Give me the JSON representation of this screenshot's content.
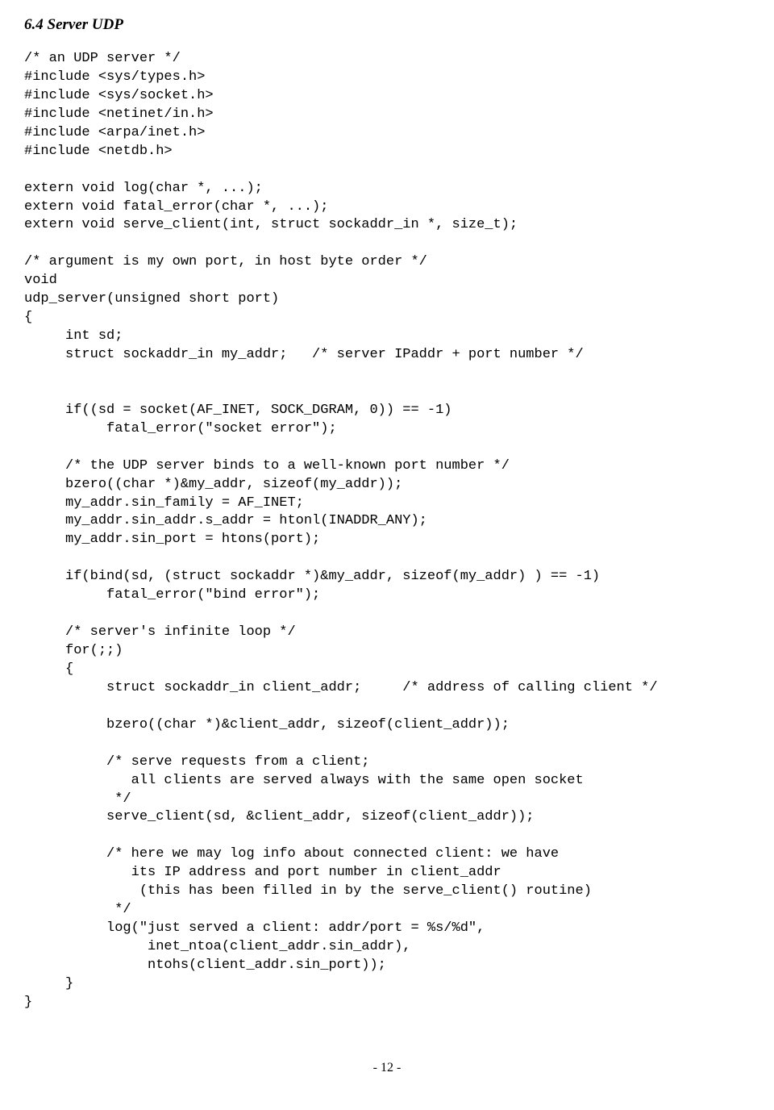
{
  "section_title": "6.4  Server UDP",
  "code": "/* an UDP server */\n#include <sys/types.h>\n#include <sys/socket.h>\n#include <netinet/in.h>\n#include <arpa/inet.h>\n#include <netdb.h>\n\nextern void log(char *, ...);\nextern void fatal_error(char *, ...);\nextern void serve_client(int, struct sockaddr_in *, size_t);\n\n/* argument is my own port, in host byte order */\nvoid\nudp_server(unsigned short port)\n{\n     int sd;\n     struct sockaddr_in my_addr;   /* server IPaddr + port number */\n\n\n     if((sd = socket(AF_INET, SOCK_DGRAM, 0)) == -1)\n          fatal_error(\"socket error\");\n\n     /* the UDP server binds to a well-known port number */\n     bzero((char *)&my_addr, sizeof(my_addr));\n     my_addr.sin_family = AF_INET;\n     my_addr.sin_addr.s_addr = htonl(INADDR_ANY);\n     my_addr.sin_port = htons(port);\n\n     if(bind(sd, (struct sockaddr *)&my_addr, sizeof(my_addr) ) == -1)\n          fatal_error(\"bind error\");\n\n     /* server's infinite loop */\n     for(;;)\n     {\n          struct sockaddr_in client_addr;     /* address of calling client */\n\n          bzero((char *)&client_addr, sizeof(client_addr));\n\n          /* serve requests from a client;\n             all clients are served always with the same open socket\n           */\n          serve_client(sd, &client_addr, sizeof(client_addr));\n\n          /* here we may log info about connected client: we have\n             its IP address and port number in client_addr\n              (this has been filled in by the serve_client() routine)\n           */\n          log(\"just served a client: addr/port = %s/%d\",\n               inet_ntoa(client_addr.sin_addr),\n               ntohs(client_addr.sin_port));\n     }\n}",
  "page_number": "- 12 -"
}
